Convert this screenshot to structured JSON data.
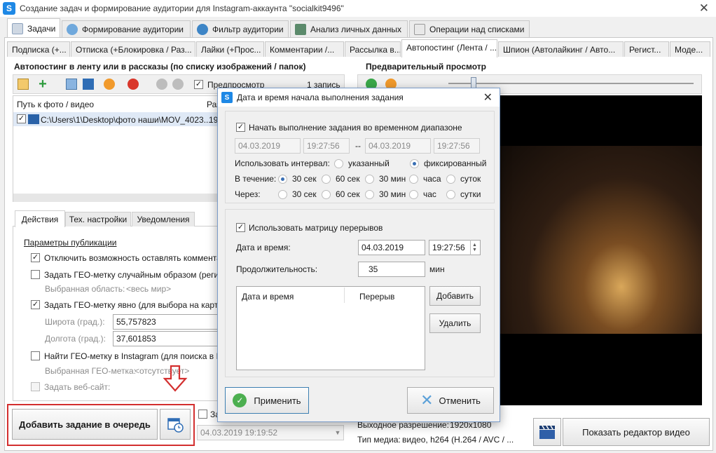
{
  "window": {
    "title": "Создание задач и формирование аудитории для Instagram-аккаунта \"socialkit9496\"",
    "close_glyph": "✕"
  },
  "main_tabs": [
    {
      "label": "Задачи"
    },
    {
      "label": "Формирование аудитории"
    },
    {
      "label": "Фильтр аудитории"
    },
    {
      "label": "Анализ личных данных"
    },
    {
      "label": "Операции над списками"
    }
  ],
  "sub_tabs": [
    {
      "label": "Подписка (+..."
    },
    {
      "label": "Отписка (+Блокировка / Раз..."
    },
    {
      "label": "Лайки (+Прос..."
    },
    {
      "label": "Комментарии /..."
    },
    {
      "label": "Рассылка в..."
    },
    {
      "label": "Автопостинг (Лента / ..."
    },
    {
      "label": "Шпион (Автолайкинг / Авто..."
    },
    {
      "label": "Регист..."
    },
    {
      "label": "Моде..."
    }
  ],
  "left": {
    "title": "Автопостинг в ленту или в рассказы (по списку изображений / папок)",
    "preview_checkbox": "Предпросмотр",
    "records": "1 запись",
    "col_path": "Путь к фото / видео",
    "col_short": "Раз",
    "row_path": "C:\\Users\\1\\Desktop\\фото наши\\MOV_4023...",
    "row_short": "19"
  },
  "bottom_tabs": {
    "actions": "Действия",
    "tech": "Тех. настройки",
    "notify": "Уведомления"
  },
  "params": {
    "header": "Параметры публикации",
    "disable_comments": "Отключить возможность оставлять комментари",
    "geo_random": "Задать ГЕО-метку случайным образом (регион м",
    "selected_area_label": "Выбранная область:",
    "selected_area_value": "<весь мир>",
    "geo_explicit": "Задать ГЕО-метку явно (для выбора на карте на",
    "lat_label": "Широта (град.):",
    "lat_value": "55,757823",
    "lon_label": "Долгота (град.):",
    "lon_value": "37,601853",
    "geo_find": "Найти ГЕО-метку в Instagram (для поиска в Inst",
    "selected_geo_label": "Выбранная ГЕО-метка:",
    "selected_geo_value": "<отсутствует>",
    "website": "Задать веб-сайт:"
  },
  "queue": {
    "add_button": "Добавить задание в очередь",
    "schedule_checkbox": "За",
    "schedule_value": "04.03.2019 19:19:52"
  },
  "preview": {
    "title": "Предварительный просмотр",
    "output_resolution_label": "Выходное разрешение:",
    "output_resolution_value": "1920x1080",
    "media_type_label": "Тип медиа:",
    "media_type_value": "видео, h264 (H.264 / AVC / ...",
    "show_editor_button": "Показать редактор видео"
  },
  "dialog": {
    "title": "Дата и время начала выполнения задания",
    "start_in_range": "Начать выполнение задания во временном диапазоне",
    "date_from": "04.03.2019",
    "time_from": "19:27:56",
    "range_sep": "--",
    "date_to": "04.03.2019",
    "time_to": "19:27:56",
    "use_interval_label": "Использовать интервал:",
    "interval_specified": "указанный",
    "interval_fixed": "фиксированный",
    "during_label": "В течение:",
    "every_label": "Через:",
    "during_opts": [
      "30 сек",
      "60 сек",
      "30 мин",
      "часа",
      "суток"
    ],
    "every_opts": [
      "30 сек",
      "60 сек",
      "30 мин",
      "час",
      "сутки"
    ],
    "use_matrix": "Использовать матрицу перерывов",
    "datetime_label": "Дата и время:",
    "matrix_date": "04.03.2019",
    "matrix_time": "19:27:56",
    "duration_label": "Продолжительность:",
    "duration_value": "35",
    "duration_unit": "мин",
    "table_col_datetime": "Дата и время",
    "table_col_break": "Перерыв",
    "add_button": "Добавить",
    "delete_button": "Удалить",
    "apply_button": "Применить",
    "cancel_button": "Отменить"
  },
  "colors": {
    "accent": "#1e88e5",
    "annotation_red": "#d32f2f",
    "apply_green": "#4caf50",
    "cancel_blue": "#5aa0d8"
  }
}
